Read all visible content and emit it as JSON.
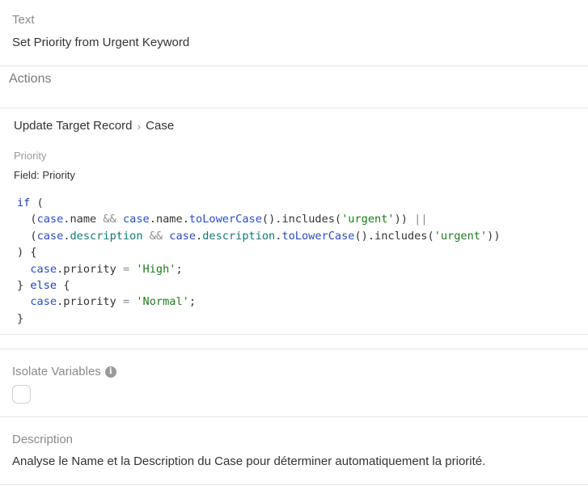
{
  "text_field": {
    "label": "Text",
    "value": "Set Priority from Urgent Keyword"
  },
  "actions": {
    "heading": "Actions",
    "breadcrumb": {
      "first": "Update Target Record",
      "separator": "›",
      "second": "Case"
    },
    "priority": {
      "label": "Priority",
      "field_text": "Field: Priority"
    },
    "code": {
      "line1": {
        "kw": "if",
        "rest": " ("
      },
      "line2": {
        "p1": "  (",
        "v1": "case",
        "d1": ".",
        "pr1": "name",
        "op1": " && ",
        "v2": "case",
        "d2": ".",
        "pr2": "name",
        "d3": ".",
        "fn1": "toLowerCase",
        "p2": "().includes(",
        "s1": "'urgent'",
        "p3": ")) ",
        "op2": "||"
      },
      "line3": {
        "p1": "  (",
        "v1": "case",
        "d1": ".",
        "pr1": "description",
        "op1": " && ",
        "v2": "case",
        "d2": ".",
        "pr2": "description",
        "d3": ".",
        "fn1": "toLowerCase",
        "p2": "().includes(",
        "s1": "'urgent'",
        "p3": "))"
      },
      "line4": {
        "text": ") {"
      },
      "line5": {
        "indent": "  ",
        "v1": "case",
        "rest": ".priority",
        "op": " = ",
        "s1": "'High'",
        "end": ";"
      },
      "line6": {
        "p1": "} ",
        "kw": "else",
        "p2": " {"
      },
      "line7": {
        "indent": "  ",
        "v1": "case",
        "rest": ".priority",
        "op": " = ",
        "s1": "'Normal'",
        "end": ";"
      },
      "line8": {
        "text": "}"
      }
    }
  },
  "isolate_variables": {
    "label": "Isolate Variables",
    "info_icon": "info-icon",
    "checked": false
  },
  "description": {
    "label": "Description",
    "value": "Analyse le Name et la Description du Case pour déterminer automatiquement la priorité."
  }
}
